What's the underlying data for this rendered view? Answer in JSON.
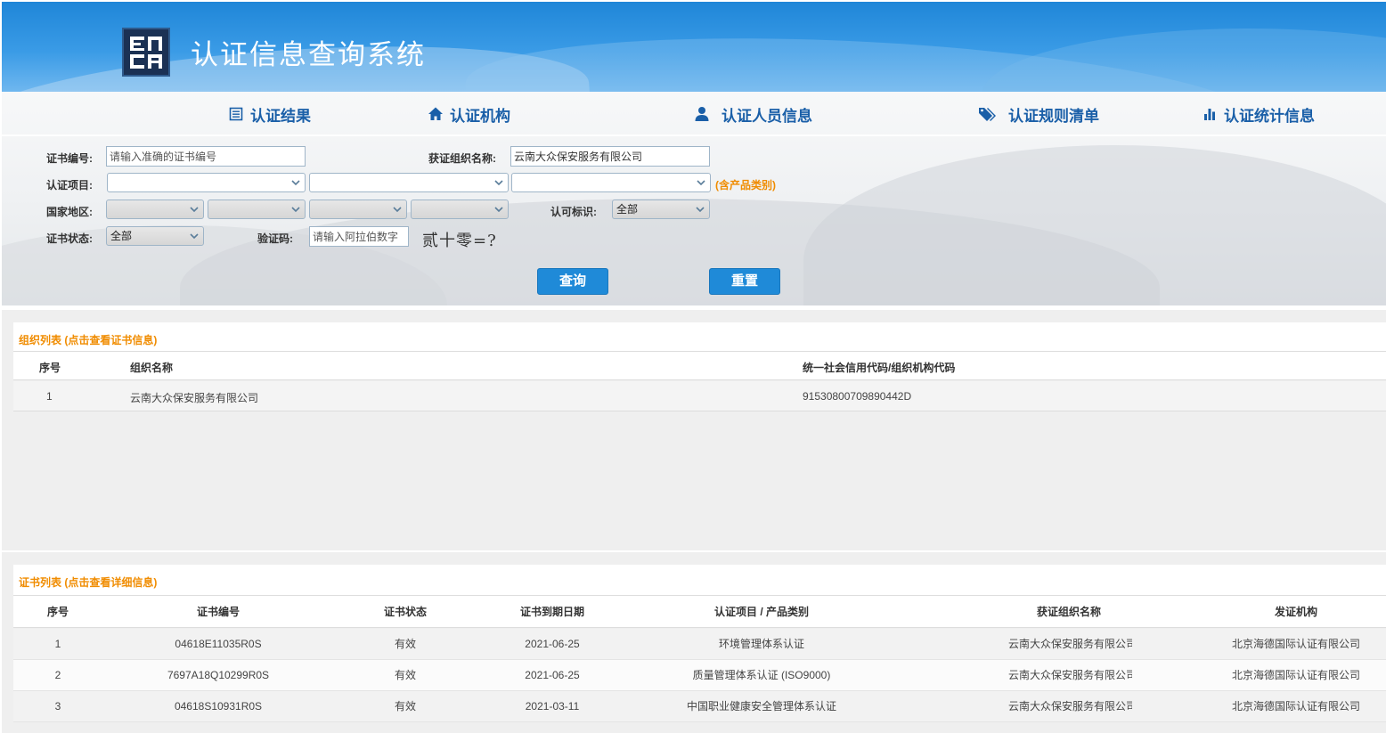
{
  "header": {
    "title": "认证信息查询系统"
  },
  "nav": [
    {
      "label": "认证结果",
      "icon": "list-icon"
    },
    {
      "label": "认证机构",
      "icon": "home-icon"
    },
    {
      "label": "认证人员信息",
      "icon": "user-icon"
    },
    {
      "label": "认证规则清单",
      "icon": "tags-icon"
    },
    {
      "label": "认证统计信息",
      "icon": "bar-chart-icon"
    }
  ],
  "search": {
    "cert_no_label": "证书编号:",
    "cert_no_placeholder": "请输入准确的证书编号",
    "org_name_label": "获证组织名称:",
    "org_name_value": "云南大众保安服务有限公司",
    "project_label": "认证项目:",
    "project_hint": "(含产品类别)",
    "region_label": "国家地区:",
    "accredit_label": "认可标识:",
    "accredit_value": "全部",
    "status_label": "证书状态:",
    "status_value": "全部",
    "captcha_label": "验证码:",
    "captcha_placeholder": "请输入阿拉伯数字",
    "captcha_text": "贰十零=?",
    "query_button": "查询",
    "reset_button": "重置"
  },
  "org_list": {
    "title": "组织列表 (点击查看证书信息)",
    "columns": [
      "序号",
      "组织名称",
      "统一社会信用代码/组织机构代码"
    ],
    "rows": [
      {
        "no": "1",
        "name": "云南大众保安服务有限公司",
        "code": "91530800709890442D"
      }
    ]
  },
  "cert_list": {
    "title": "证书列表 (点击查看详细信息)",
    "columns": [
      "序号",
      "证书编号",
      "证书状态",
      "证书到期日期",
      "认证项目 / 产品类别",
      "获证组织名称",
      "发证机构"
    ],
    "rows": [
      {
        "no": "1",
        "cert_no": "04618E11035R0S",
        "status": "有效",
        "expiry": "2021-06-25",
        "project": "环境管理体系认证",
        "org": "云南大众保安服务有限公司",
        "issuer": "北京海德国际认证有限公司"
      },
      {
        "no": "2",
        "cert_no": "7697A18Q10299R0S",
        "status": "有效",
        "expiry": "2021-06-25",
        "project": "质量管理体系认证 (ISO9000)",
        "org": "云南大众保安服务有限公司",
        "issuer": "北京海德国际认证有限公司"
      },
      {
        "no": "3",
        "cert_no": "04618S10931R0S",
        "status": "有效",
        "expiry": "2021-03-11",
        "project": "中国职业健康安全管理体系认证",
        "org": "云南大众保安服务有限公司",
        "issuer": "北京海德国际认证有限公司"
      }
    ]
  },
  "colors": {
    "brand_blue": "#1f86d8",
    "nav_blue": "#1a5fa8",
    "accent_orange": "#f08c00"
  }
}
